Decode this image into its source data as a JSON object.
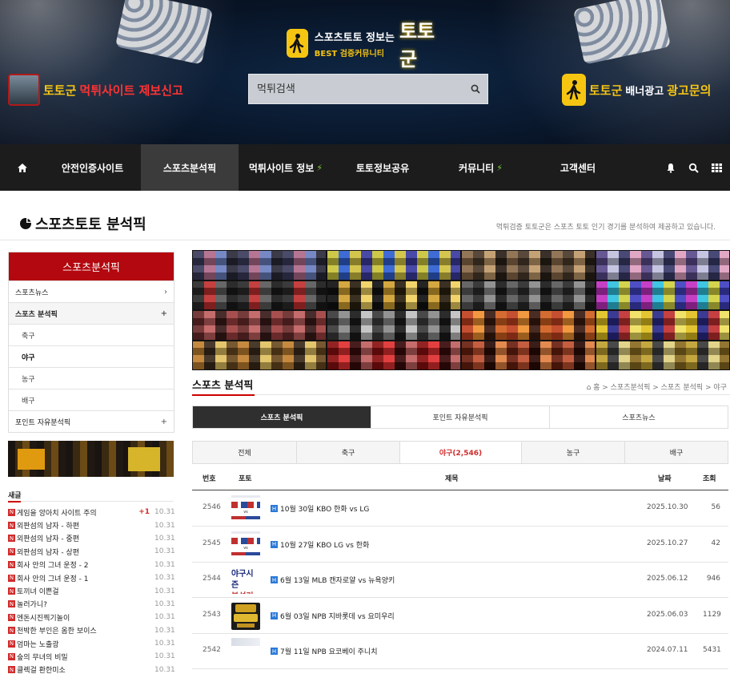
{
  "header": {
    "logo_top": "스포츠토토 정보는",
    "logo_bottom": "BEST 검증커뮤니티",
    "logo_big": "토토군",
    "search_placeholder": "먹튀검색",
    "ad_left_brand": "토토군",
    "ad_left_text": "먹튀사이트 제보신고",
    "ad_right_brand": "토토군",
    "ad_right_text": "배너광고",
    "ad_right_highlight": "광고문의"
  },
  "nav": {
    "items": [
      {
        "label": "안전인증사이트",
        "active": false,
        "bolt": false
      },
      {
        "label": "스포츠분석픽",
        "active": true,
        "bolt": false
      },
      {
        "label": "먹튀사이트 정보",
        "active": false,
        "bolt": true
      },
      {
        "label": "토토정보공유",
        "active": false,
        "bolt": false
      },
      {
        "label": "커뮤니티",
        "active": false,
        "bolt": true
      },
      {
        "label": "고객센터",
        "active": false,
        "bolt": false
      }
    ]
  },
  "page": {
    "title": "스포츠토토 분석픽",
    "description": "먹튀검증 토토군은 스포츠 토토 인기 경기를 분석하여 제공하고 있습니다."
  },
  "sidebar": {
    "heading": "스포츠분석픽",
    "items": [
      {
        "label": "스포츠뉴스",
        "control": "›",
        "type": "top"
      },
      {
        "label": "스포츠 분석픽",
        "control": "+",
        "type": "top-bold"
      },
      {
        "label": "축구",
        "control": "",
        "type": "sub"
      },
      {
        "label": "야구",
        "control": "",
        "type": "sub-active"
      },
      {
        "label": "농구",
        "control": "",
        "type": "sub"
      },
      {
        "label": "배구",
        "control": "",
        "type": "sub"
      },
      {
        "label": "포인트 자유분석픽",
        "control": "+",
        "type": "top"
      }
    ],
    "recent_label": "새글",
    "recent": [
      {
        "title": "게임을 앙아치 사이트 주의",
        "count": "+1",
        "date": "10.31"
      },
      {
        "title": "외판섬의 남자 - 하편",
        "count": "",
        "date": "10.31"
      },
      {
        "title": "외판섬의 남자 - 중편",
        "count": "",
        "date": "10.31"
      },
      {
        "title": "외판섬의 남자 - 상편",
        "count": "",
        "date": "10.31"
      },
      {
        "title": "회사 안의 그녀 운정 - 2",
        "count": "",
        "date": "10.31"
      },
      {
        "title": "회사 안의 그녀 운정 - 1",
        "count": "",
        "date": "10.31"
      },
      {
        "title": "토끼녀 이쁜걸",
        "count": "",
        "date": "10.31"
      },
      {
        "title": "놀러가니?",
        "count": "",
        "date": "10.31"
      },
      {
        "title": "엔돈시진찍기놀이",
        "count": "",
        "date": "10.31"
      },
      {
        "title": "천박한 부인은 옴한 보이스",
        "count": "",
        "date": "10.31"
      },
      {
        "title": "엄마는 노출광",
        "count": "",
        "date": "10.31"
      },
      {
        "title": "숲의 무녀의 비밀",
        "count": "",
        "date": "10.31"
      },
      {
        "title": "클렉걸 환한미소",
        "count": "",
        "date": "10.31"
      }
    ]
  },
  "section": {
    "title": "스포츠 분석픽",
    "breadcrumb": "홈 > 스포츠분석픽 > 스포츠 분석픽 > 야구",
    "tabs": [
      {
        "label": "스포츠 분석픽",
        "active": true
      },
      {
        "label": "포인트 자유분석픽",
        "active": false
      },
      {
        "label": "스포츠뉴스",
        "active": false
      }
    ],
    "subtabs": [
      {
        "label": "전체",
        "active": false
      },
      {
        "label": "축구",
        "active": false
      },
      {
        "label": "야구(2,546)",
        "active": true
      },
      {
        "label": "농구",
        "active": false
      },
      {
        "label": "배구",
        "active": false
      }
    ]
  },
  "table": {
    "headers": {
      "num": "번호",
      "photo": "포토",
      "title": "제목",
      "date": "날짜",
      "views": "조회"
    },
    "rows": [
      {
        "num": "2546",
        "title": "10월 30일 KBO 한화 vs LG",
        "date": "2025.10.30",
        "views": "56",
        "thumb": "match"
      },
      {
        "num": "2545",
        "title": "10월 27일 KBO LG vs 한화",
        "date": "2025.10.27",
        "views": "42",
        "thumb": "match"
      },
      {
        "num": "2544",
        "title": "6월 13일 MLB 캔자로얄 vs 뉴욕양키",
        "date": "2025.06.12",
        "views": "946",
        "thumb": "text"
      },
      {
        "num": "2543",
        "title": "6월 03일 NPB 지바롯데 vs 요미우리",
        "date": "2025.06.03",
        "views": "1129",
        "thumb": "logo"
      },
      {
        "num": "2542",
        "title": "7월 11일 NPB 요코베이 주니치",
        "date": "2024.07.11",
        "views": "5431",
        "thumb": "plain"
      }
    ]
  },
  "colors": {
    "accent_red": "#b3080f",
    "nav_bg": "#1c1c1c",
    "brand_yellow": "#f6c512",
    "badge_blue": "#2a79d8"
  }
}
